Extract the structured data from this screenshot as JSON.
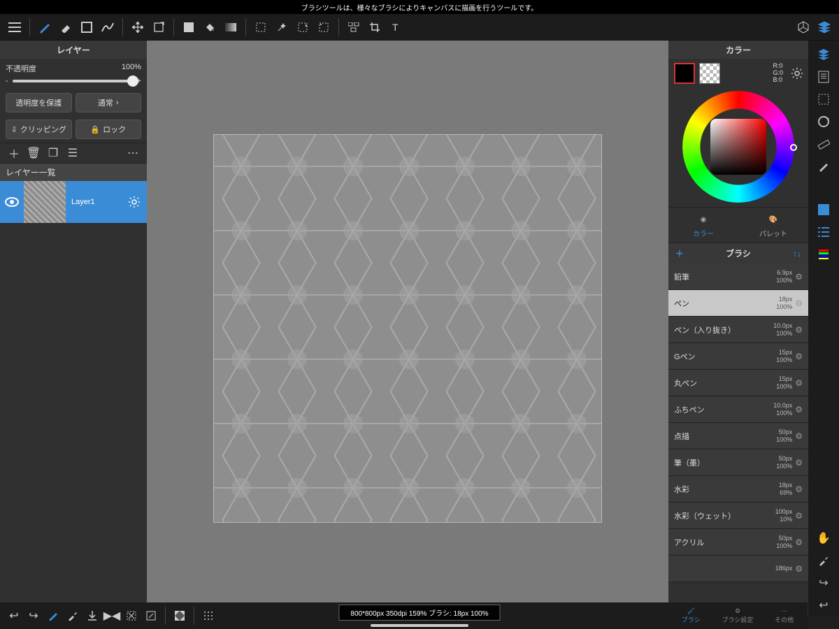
{
  "tooltip": "ブラシツールは、様々なブラシによりキャンバスに描画を行うツールです。",
  "left": {
    "title": "レイヤー",
    "opacity_label": "不透明度",
    "opacity_value": "100%",
    "protect_alpha": "透明度を保護",
    "blend": "通常",
    "clipping": "クリッピング",
    "lock": "ロック",
    "list_label": "レイヤー一覧",
    "layer_name": "Layer1"
  },
  "color": {
    "title": "カラー",
    "r": "R:0",
    "g": "G:0",
    "b": "B:0",
    "tab_color": "カラー",
    "tab_palette": "パレット"
  },
  "brush": {
    "title": "ブラシ",
    "items": [
      {
        "name": "鉛筆",
        "size": "6.9px",
        "op": "100%"
      },
      {
        "name": "ペン",
        "size": "18px",
        "op": "100%"
      },
      {
        "name": "ペン（入り抜き）",
        "size": "10.0px",
        "op": "100%"
      },
      {
        "name": "Gペン",
        "size": "15px",
        "op": "100%"
      },
      {
        "name": "丸ペン",
        "size": "15px",
        "op": "100%"
      },
      {
        "name": "ふちペン",
        "size": "10.0px",
        "op": "100%"
      },
      {
        "name": "点描",
        "size": "50px",
        "op": "100%"
      },
      {
        "name": "筆（墨）",
        "size": "50px",
        "op": "100%"
      },
      {
        "name": "水彩",
        "size": "18px",
        "op": "69%"
      },
      {
        "name": "水彩（ウェット）",
        "size": "100px",
        "op": "10%"
      },
      {
        "name": "アクリル",
        "size": "50px",
        "op": "100%"
      },
      {
        "name": "",
        "size": "186px",
        "op": ""
      }
    ],
    "selected": 1
  },
  "bottom_tabs": {
    "brush": "ブラシ",
    "settings": "ブラシ設定",
    "other": "その他"
  },
  "status": "800*800px 350dpi 159% ブラシ: 18px 100%"
}
